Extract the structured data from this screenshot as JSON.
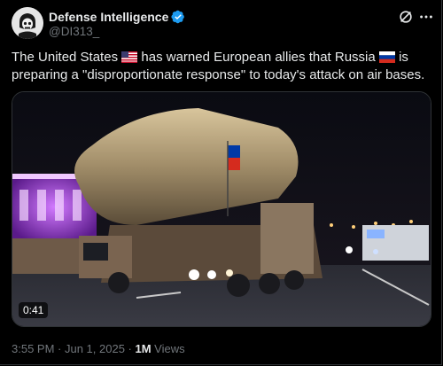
{
  "author": {
    "name": "Defense Intelligence",
    "handle": "@DI313_",
    "verified": true
  },
  "icons": {
    "avatar": "skull-helmet-avatar",
    "verified": "verified-badge-icon",
    "grok": "grok-icon",
    "more": "more-icon",
    "flag_us": "us-flag-icon",
    "flag_ru": "russia-flag-icon"
  },
  "post": {
    "text_part1": "The United States ",
    "text_part2": " has warned European allies that Russia ",
    "text_part3": " is preparing a \"disproportionate response\" to today's attack on air bases."
  },
  "media": {
    "type": "video",
    "duration": "0:41"
  },
  "meta": {
    "time": "3:55 PM",
    "separator": " · ",
    "date": "Jun 1, 2025",
    "views_count": "1M",
    "views_label": " Views"
  },
  "colors": {
    "background": "#000000",
    "text": "#e7e9ea",
    "secondary": "#71767b",
    "verified": "#1d9bf0"
  }
}
